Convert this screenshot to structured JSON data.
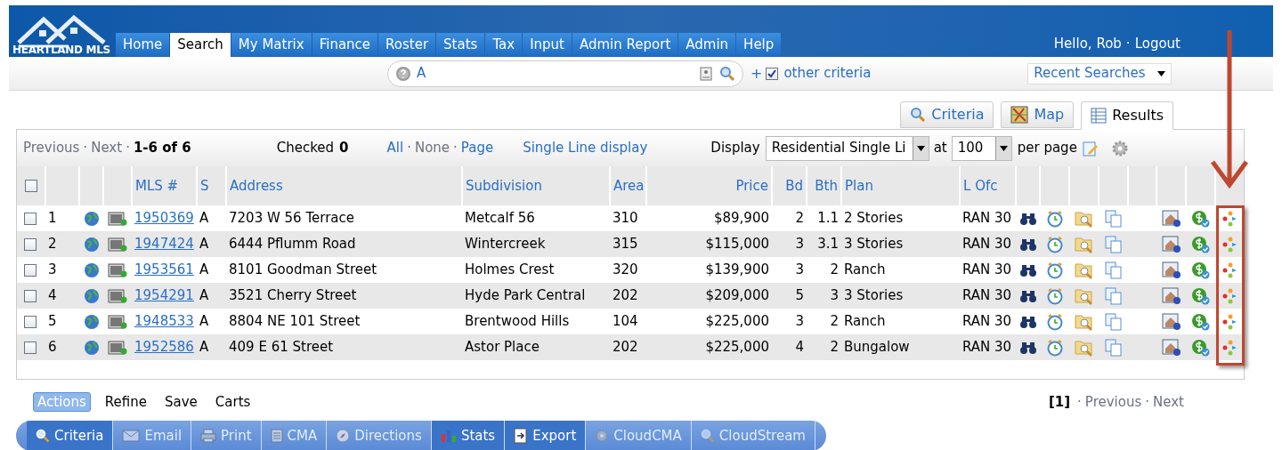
{
  "logo": {
    "text": "HEARTLAND MLS"
  },
  "nav_tabs": [
    {
      "label": "Home",
      "selected": false
    },
    {
      "label": "Search",
      "selected": true
    },
    {
      "label": "My Matrix",
      "selected": false
    },
    {
      "label": "Finance",
      "selected": false
    },
    {
      "label": "Roster",
      "selected": false
    },
    {
      "label": "Stats",
      "selected": false
    },
    {
      "label": "Tax",
      "selected": false
    },
    {
      "label": "Input",
      "selected": false
    },
    {
      "label": "Admin Report",
      "selected": false
    },
    {
      "label": "Admin",
      "selected": false
    },
    {
      "label": "Help",
      "selected": false
    }
  ],
  "user": {
    "greeting": "Hello, Rob",
    "separator": "·",
    "logout": "Logout"
  },
  "search_bar": {
    "value": "A",
    "plus": "+",
    "other_criteria": {
      "label": "other criteria",
      "checked": true
    },
    "recent_searches": "Recent Searches"
  },
  "view_tabs": [
    {
      "label": "Criteria",
      "kind": "criteria",
      "selected": false
    },
    {
      "label": "Map",
      "kind": "map",
      "selected": false
    },
    {
      "label": "Results",
      "kind": "results",
      "selected": true
    }
  ],
  "toolbar": {
    "separator": "·",
    "previous": "Previous",
    "next": "Next",
    "range": "1-6 of 6",
    "checked_label": "Checked",
    "checked_count": "0",
    "all": "All",
    "none": "None",
    "page": "Page",
    "single_line": "Single Line display",
    "display_label": "Display",
    "display_value": "Residential Single Li",
    "at": "at",
    "per_page_value": "100",
    "per_page": "per page"
  },
  "table": {
    "header_checked": false,
    "columns": [
      "MLS #",
      "S",
      "Address",
      "Subdivision",
      "Area",
      "Price",
      "Bd",
      "Bth",
      "Plan",
      "L Ofc"
    ],
    "rows": [
      {
        "checked": false,
        "num": "1",
        "mls": "1950369",
        "s": "A",
        "address": "7203 W 56 Terrace",
        "subdivision": "Metcalf 56",
        "area": "310",
        "price": "$89,900",
        "bd": "2",
        "bth": "1.1",
        "plan": "2 Stories",
        "lofc": "RAN 30"
      },
      {
        "checked": false,
        "num": "2",
        "mls": "1947424",
        "s": "A",
        "address": "6444 Pflumm Road",
        "subdivision": "Wintercreek",
        "area": "315",
        "price": "$115,000",
        "bd": "3",
        "bth": "3.1",
        "plan": "3 Stories",
        "lofc": "RAN 30"
      },
      {
        "checked": false,
        "num": "3",
        "mls": "1953561",
        "s": "A",
        "address": "8101 Goodman Street",
        "subdivision": "Holmes Crest",
        "area": "320",
        "price": "$139,900",
        "bd": "3",
        "bth": "2",
        "plan": "Ranch",
        "lofc": "RAN 30"
      },
      {
        "checked": false,
        "num": "4",
        "mls": "1954291",
        "s": "A",
        "address": "3521 Cherry Street",
        "subdivision": "Hyde Park Central",
        "area": "202",
        "price": "$209,000",
        "bd": "5",
        "bth": "3",
        "plan": "3 Stories",
        "lofc": "RAN 30"
      },
      {
        "checked": false,
        "num": "5",
        "mls": "1948533",
        "s": "A",
        "address": "8804 NE 101 Street",
        "subdivision": "Brentwood Hills",
        "area": "104",
        "price": "$225,000",
        "bd": "3",
        "bth": "2",
        "plan": "Ranch",
        "lofc": "RAN 30"
      },
      {
        "checked": false,
        "num": "6",
        "mls": "1952586",
        "s": "A",
        "address": "409 E 61 Street",
        "subdivision": "Astor Place",
        "area": "202",
        "price": "$225,000",
        "bd": "4",
        "bth": "2",
        "plan": "Bungalow",
        "lofc": "RAN 30"
      }
    ]
  },
  "bottom_pager": {
    "separator": "·",
    "current": "[1]",
    "previous": "Previous",
    "next": "Next"
  },
  "action_tabs": [
    {
      "label": "Actions",
      "selected": true
    },
    {
      "label": "Refine",
      "selected": false
    },
    {
      "label": "Save",
      "selected": false
    },
    {
      "label": "Carts",
      "selected": false
    }
  ],
  "actions": [
    {
      "label": "Criteria",
      "kind": "search",
      "disabled": false
    },
    {
      "label": "Email",
      "kind": "email",
      "disabled": true
    },
    {
      "label": "Print",
      "kind": "print",
      "disabled": true
    },
    {
      "label": "CMA",
      "kind": "doc",
      "disabled": true
    },
    {
      "label": "Directions",
      "kind": "compass",
      "disabled": true
    },
    {
      "label": "Stats",
      "kind": "chart",
      "disabled": false
    },
    {
      "label": "Export",
      "kind": "export",
      "disabled": false
    },
    {
      "label": "CloudCMA",
      "kind": "gear",
      "disabled": true
    },
    {
      "label": "CloudStream",
      "kind": "search",
      "disabled": true
    }
  ]
}
